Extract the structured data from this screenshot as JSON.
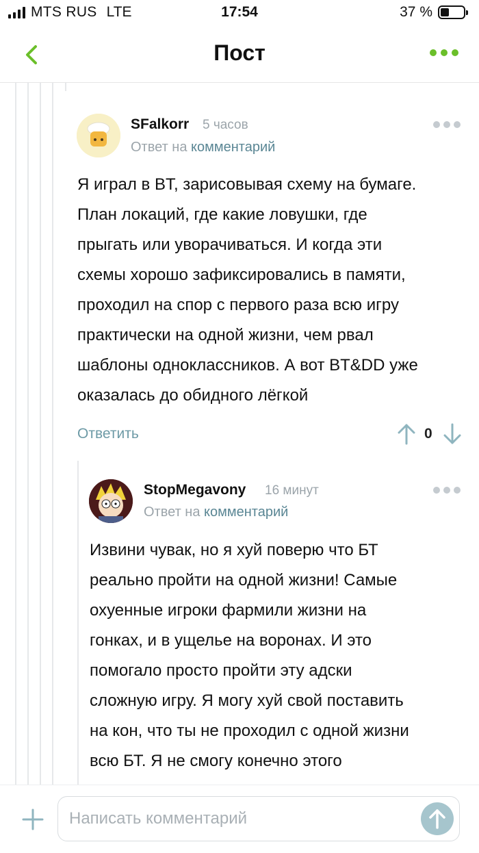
{
  "status_bar": {
    "carrier": "MTS RUS",
    "network": "LTE",
    "time": "17:54",
    "battery": "37 %",
    "battery_level": 0.37
  },
  "nav": {
    "title": "Пост",
    "back_icon": "chevron-left-icon",
    "menu_icon": "more-dots-icon",
    "accent_color": "#6bbf2a"
  },
  "comments": [
    {
      "username": "SFalkorr",
      "time": "5 часов",
      "reply_prefix": "Ответ на",
      "reply_link": "комментарий",
      "text": "Я играл в BT, зарисовывая схему на бумаге.\nПлан локаций, где какие ловушки, где\nпрыгать или уворачиваться. И когда эти\nсхемы хорошо зафиксировались в памяти,\nпроходил на спор с первого раза всю игру\nпрактически на одной жизни, чем рвал\nшаблоны одноклассников. А вот BT&DD уже\nоказалась до обидного лёгкой",
      "reply_label": "Ответить",
      "score": "0"
    },
    {
      "username": "StopMegavony",
      "time": "16 минут",
      "reply_prefix": "Ответ на",
      "reply_link": "комментарий",
      "text": "Извини чувак, но я хуй поверю что БТ\nреально пройти на одной жизни! Самые\nохуенные игроки фармили жизни на\nгонках, и в ущелье на воронах. И это\nпомогало просто пройти эту адски\nсложную игру. Я могу хуй свой поставить\nна кон, что ты не проходил с одной жизни\nвсю БТ. Я не смогу конечно этого"
    }
  ],
  "composer": {
    "placeholder": "Написать комментарий",
    "plus_icon": "plus-icon",
    "send_icon": "send-arrow-up-icon",
    "send_color": "#a6c5cd"
  }
}
